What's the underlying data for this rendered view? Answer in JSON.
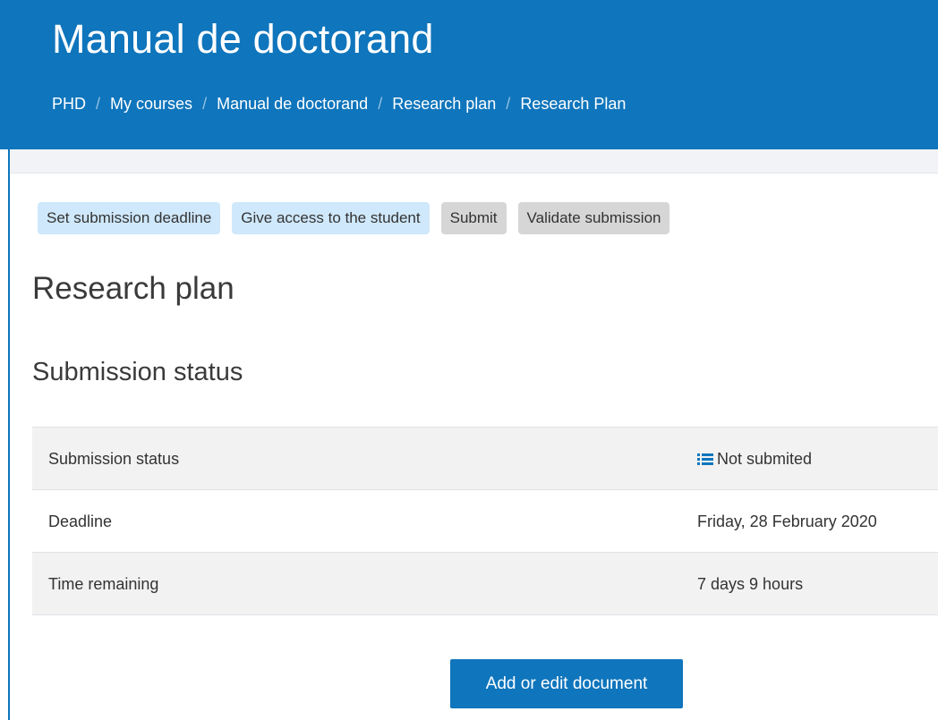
{
  "header": {
    "title": "Manual de doctorand",
    "breadcrumb": [
      "PHD",
      "My courses",
      "Manual de doctorand",
      "Research plan",
      "Research Plan"
    ],
    "separator": "/",
    "background_color": "#0f75bc"
  },
  "actions": {
    "set_deadline": "Set submission deadline",
    "give_access": "Give access to the student",
    "submit": "Submit",
    "validate": "Validate submission"
  },
  "main": {
    "page_title": "Research plan",
    "section_title": "Submission status",
    "status_rows": [
      {
        "label": "Submission status",
        "value": "Not submited",
        "icon": "list-icon"
      },
      {
        "label": "Deadline",
        "value": "Friday, 28 February 2020"
      },
      {
        "label": "Time remaining",
        "value": "7 days 9 hours"
      }
    ],
    "primary_button": "Add or edit document"
  },
  "colors": {
    "accent": "#0f75bc",
    "pill_active": "#cfe8fb",
    "pill_disabled": "#d6d6d6"
  }
}
